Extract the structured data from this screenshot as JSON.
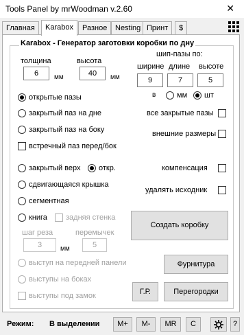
{
  "window": {
    "title": "Tools Panel by mrWoodman v.2.60",
    "close_glyph": "✕"
  },
  "tabs": [
    {
      "label": "Главная"
    },
    {
      "label": "Karabox"
    },
    {
      "label": "Разное"
    },
    {
      "label": "Nesting"
    },
    {
      "label": "Принт"
    },
    {
      "label": "$"
    }
  ],
  "active_tab": "Karabox",
  "group": {
    "title": "Karabox - Генератор заготовки коробки по дну"
  },
  "dims": {
    "thickness_label": "толщина",
    "thickness_value": "6",
    "thickness_unit": "мм",
    "height_label": "высота",
    "height_value": "40",
    "height_unit": "мм"
  },
  "slots": {
    "header": "шип-пазы по:",
    "width_label": "ширине",
    "width_value": "9",
    "length_label": "длине",
    "length_value": "7",
    "height_label": "высоте",
    "height_value": "5",
    "in_label": "в",
    "mm_label": "мм",
    "pcs_label": "шт",
    "selected_unit": "шт"
  },
  "slot_types": {
    "open": "открытые пазы",
    "closed_bottom": "закрытый паз на дне",
    "closed_side": "закрытый паз на боку",
    "counter": "встречный паз перед/бок",
    "selected": "открытые пазы"
  },
  "right_checks": {
    "all_closed": "все закрытые пазы",
    "outer_dims": "внешние размеры",
    "compensation": "компенсация",
    "delete_source": "удалять исходник"
  },
  "top_types": {
    "closed_top": "закрытый верх",
    "open": "откр.",
    "sliding_lid": "сдвигающаяся крышка",
    "segment": "сегментная",
    "book": "книга",
    "back_wall": "задняя стенка",
    "selected": "откр."
  },
  "cut": {
    "step_label": "шаг реза",
    "step_value": "3",
    "step_unit": "мм",
    "bridges_label": "перемычек",
    "bridges_value": "5"
  },
  "extras": {
    "front_ledge": "выступ на передней панели",
    "side_ledges": "выступы на боках",
    "lock_ledges": "выступы под замок"
  },
  "buttons": {
    "create": "Создать коробку",
    "hardware": "Фурнитура",
    "gr": "Г.Р.",
    "partitions": "Перегородки"
  },
  "status": {
    "mode_label": "Режим:",
    "mode_value": "В выделении",
    "mplus": "M+",
    "mminus": "M-",
    "mr": "MR",
    "c": "C",
    "help": "?"
  }
}
